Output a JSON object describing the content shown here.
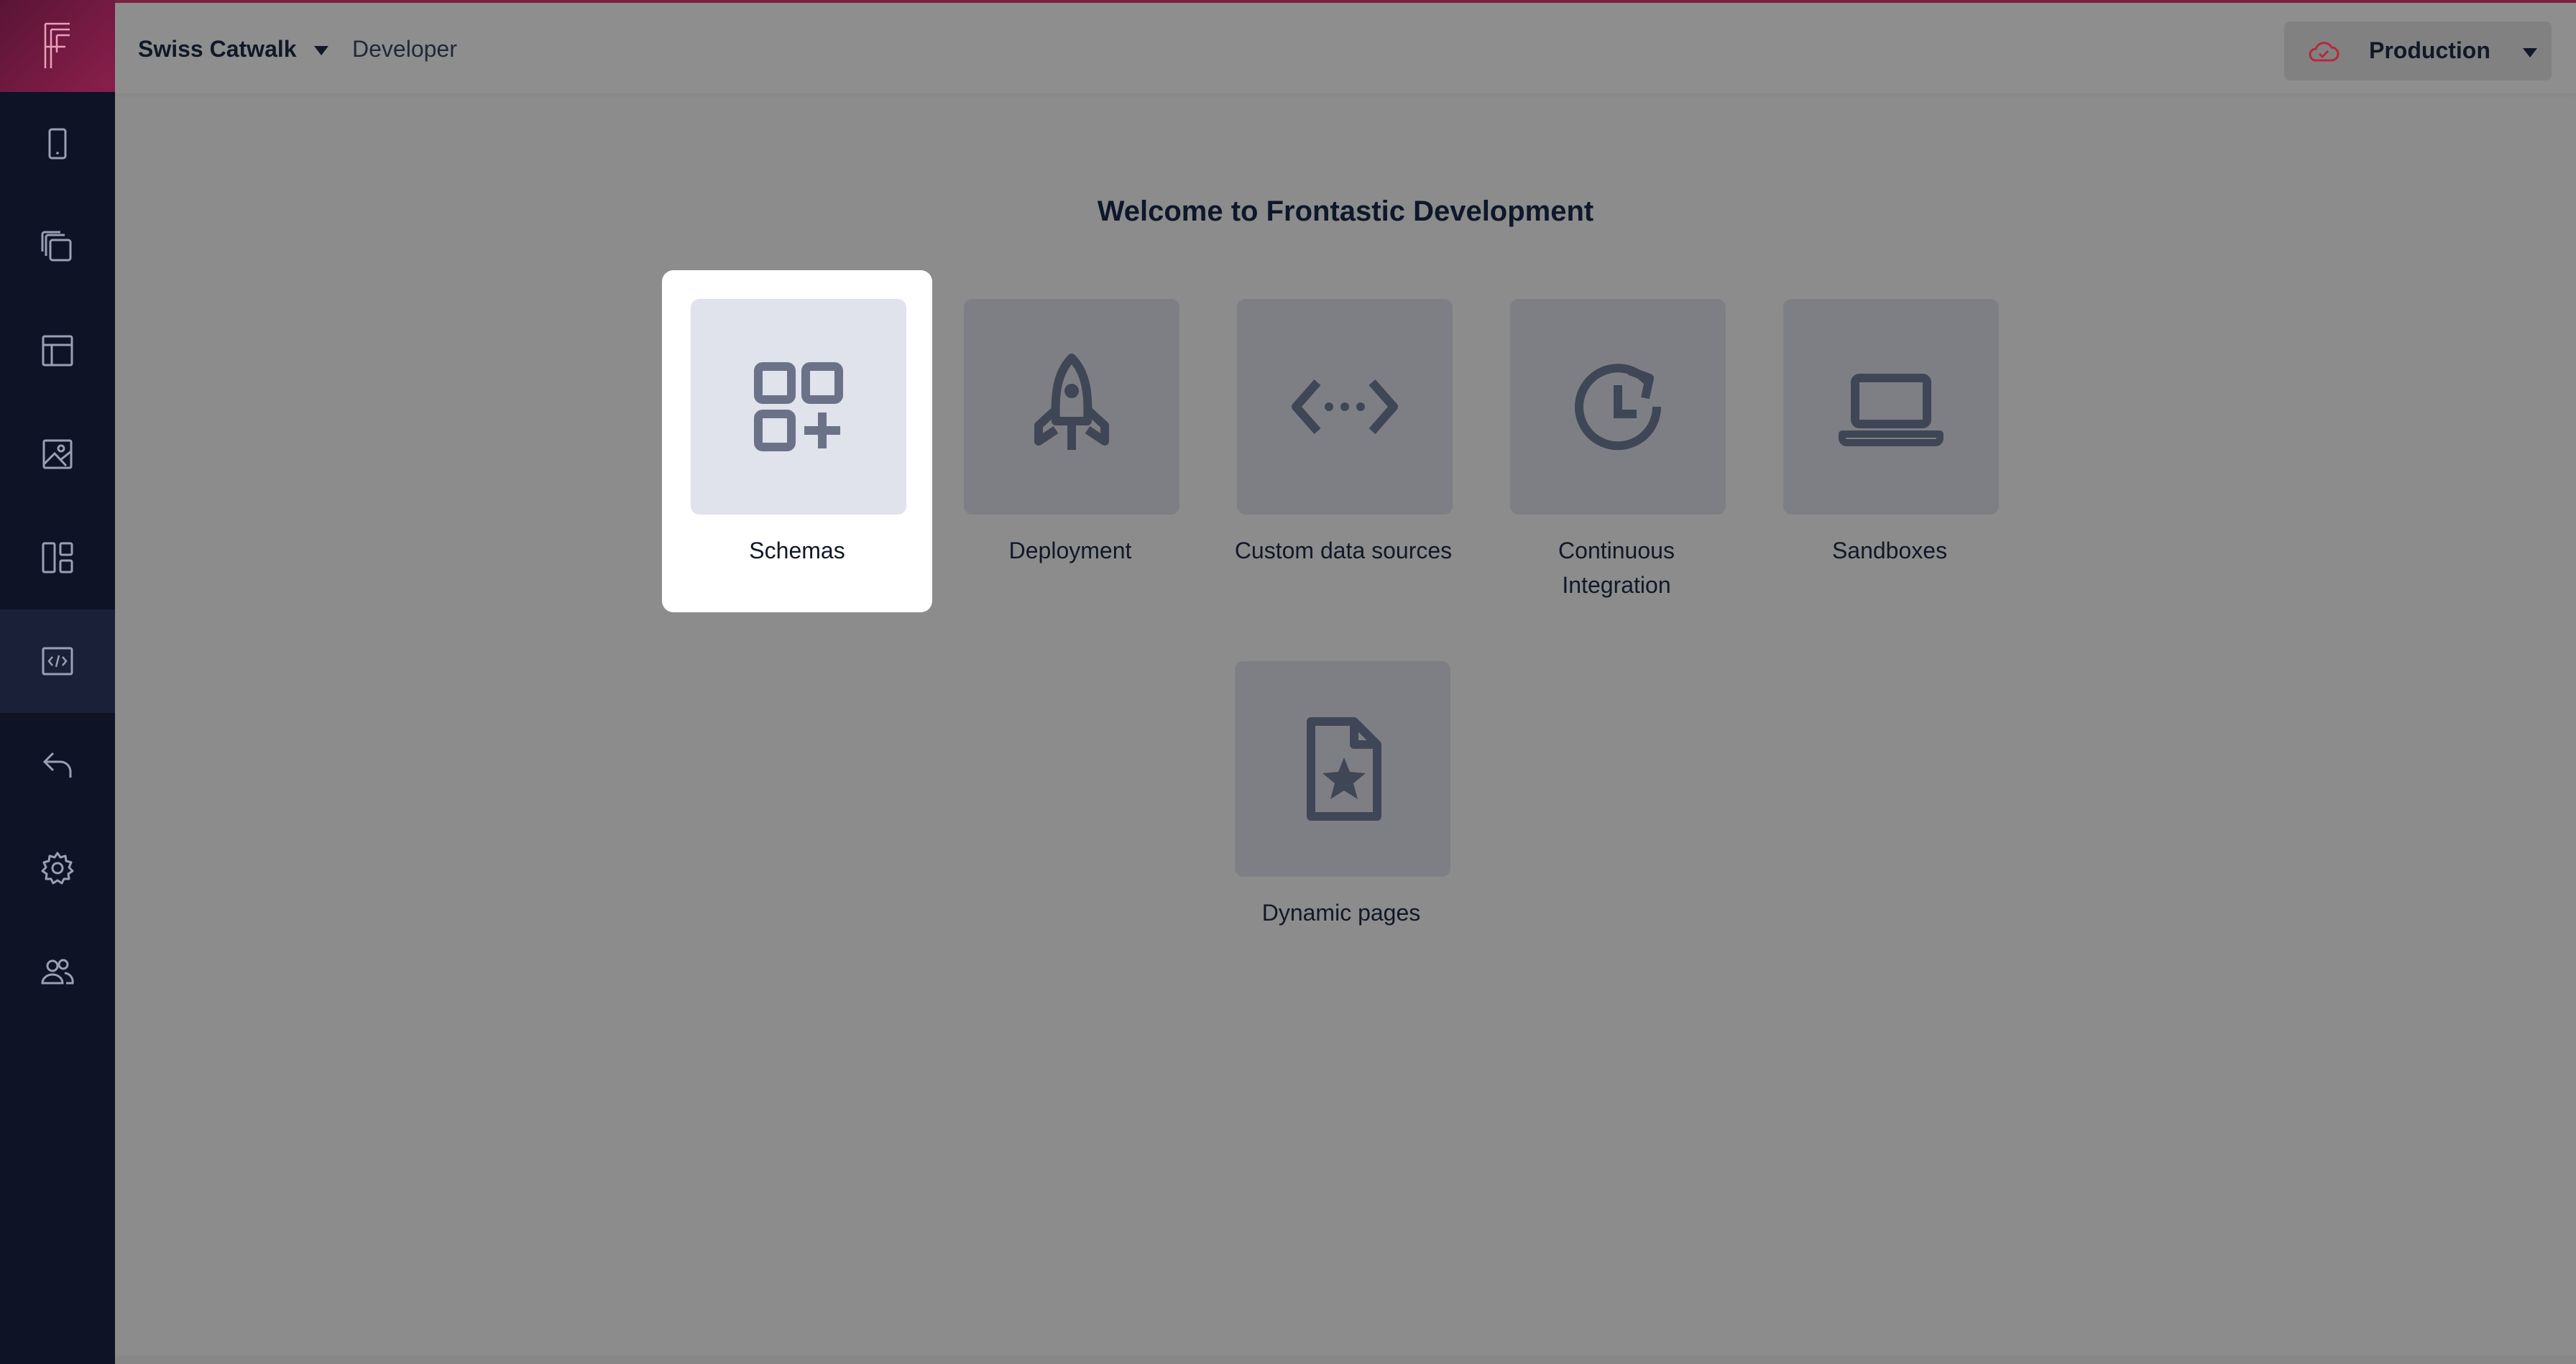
{
  "topbar": {
    "project_name": "Swiss Catwalk",
    "section": "Developer",
    "environment": "Production",
    "accent_color": "#7a2040"
  },
  "sidebar": {
    "logo": "frontastic-logo",
    "items": [
      {
        "icon": "tablet-icon"
      },
      {
        "icon": "pages-icon"
      },
      {
        "icon": "layout-icon"
      },
      {
        "icon": "media-icon"
      },
      {
        "icon": "components-icon"
      },
      {
        "icon": "developer-code-icon",
        "active": true
      },
      {
        "icon": "undo-icon"
      },
      {
        "icon": "settings-icon"
      },
      {
        "icon": "users-icon"
      }
    ]
  },
  "main": {
    "title": "Welcome to Frontastic Development",
    "cards": [
      {
        "label": "Schemas",
        "icon": "schemas-icon",
        "selected": true
      },
      {
        "label": "Deployment",
        "icon": "rocket-icon"
      },
      {
        "label": "Custom data sources",
        "icon": "code-dots-icon"
      },
      {
        "label_line1": "Continuous",
        "label_line2": "Integration",
        "icon": "refresh-clock-icon"
      },
      {
        "label": "Sandboxes",
        "icon": "laptop-icon"
      },
      {
        "label": "Dynamic pages",
        "icon": "file-star-icon"
      }
    ]
  }
}
